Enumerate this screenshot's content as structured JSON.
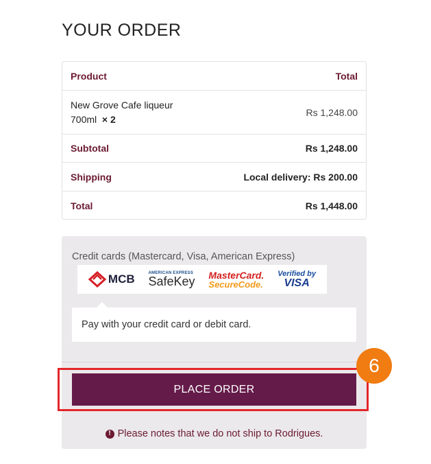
{
  "title": "YOUR ORDER",
  "table": {
    "header": {
      "product": "Product",
      "total": "Total"
    },
    "item": {
      "name": "New Grove Cafe liqueur",
      "variant": "700ml",
      "qty": "× 2",
      "price": "Rs 1,248.00"
    },
    "subtotal": {
      "label": "Subtotal",
      "value": "Rs 1,248.00"
    },
    "shipping": {
      "label": "Shipping",
      "value": "Local delivery: Rs 200.00"
    },
    "total": {
      "label": "Total",
      "value": "Rs 1,448.00"
    }
  },
  "payment": {
    "method_label": "Credit cards (Mastercard, Visa, American Express)",
    "logos": {
      "mcb": "MCB",
      "amex_top": "AMERICAN EXPRESS",
      "safekey": "SafeKey",
      "mastercard": "MasterCard.",
      "securecode": "SecureCode.",
      "verified_by": "Verified by",
      "visa": "VISA"
    },
    "description": "Pay with your credit card or debit card.",
    "button": "PLACE ORDER"
  },
  "step_number": "6",
  "notice": "Please notes that we do not ship to Rodrigues.",
  "colors": {
    "accent": "#651b49",
    "label": "#6b1a32",
    "highlight": "#e3262a",
    "badge": "#f07c12"
  }
}
